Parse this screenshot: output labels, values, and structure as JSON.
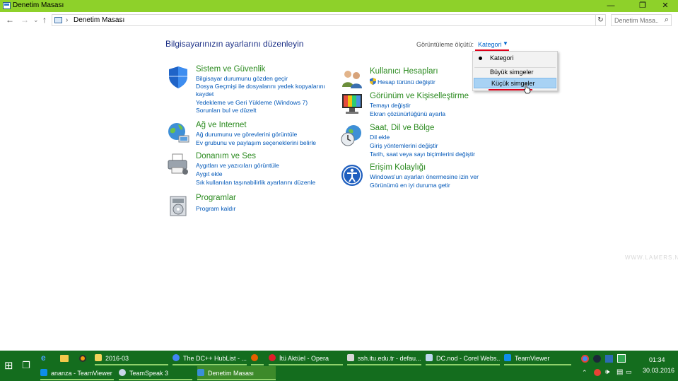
{
  "window": {
    "title": "Denetim Masası",
    "minimize": "—",
    "restore": "❐",
    "close": "✕"
  },
  "address": {
    "back": "←",
    "forward": "→",
    "recent": "⌄",
    "up": "↑",
    "separator": "›",
    "breadcrumb": "Denetim Masası",
    "breadcrumb_dropdown": "›",
    "refresh": "↻",
    "search_placeholder": "Denetim Masa...",
    "search_icon": "⌕"
  },
  "main": {
    "heading": "Bilgisayarınızın ayarlarını düzenleyin",
    "view_label": "Görüntüleme ölçütü:",
    "view_value": "Kategori",
    "view_caret": "▼"
  },
  "categories_left": [
    {
      "title": "Sistem ve Güvenlik",
      "icon": "shield-icon",
      "links": [
        "Bilgisayar durumunu gözden geçir",
        "Dosya Geçmişi ile dosyalarını yedek kopyalarını",
        "kaydet",
        "Yedekleme ve Geri Yükleme (Windows 7)",
        "Sorunları bul ve düzelt"
      ]
    },
    {
      "title": "Ağ ve Internet",
      "icon": "network-globe-icon",
      "links": [
        "Ağ durumunu ve görevlerini görüntüle",
        "Ev grubunu ve paylaşım seçeneklerini belirle"
      ]
    },
    {
      "title": "Donanım ve Ses",
      "icon": "printer-icon",
      "links": [
        "Aygıtları ve yazıcıları görüntüle",
        "Aygıt ekle",
        "Sık kullanılan taşınabilirlik ayarlarını düzenle"
      ]
    },
    {
      "title": "Programlar",
      "icon": "programs-disc-icon",
      "links": [
        "Program kaldır"
      ]
    }
  ],
  "categories_right": [
    {
      "title": "Kullanıcı Hesapları",
      "icon": "users-icon",
      "links": [
        "Hesap türünü değiştir"
      ]
    },
    {
      "title": "Görünüm ve Kişiselleştirme",
      "icon": "monitor-icon",
      "links": [
        "Temayı değiştir",
        "Ekran çözünürlüğünü ayarla"
      ]
    },
    {
      "title": "Saat, Dil ve Bölge",
      "icon": "clock-globe-icon",
      "links": [
        "Dil ekle",
        "Giriş yöntemlerini değiştir",
        "Tarih, saat veya sayı biçimlerini değiştir"
      ]
    },
    {
      "title": "Erişim Kolaylığı",
      "icon": "accessibility-icon",
      "links": [
        "Windows'un ayarları önermesine izin ver",
        "Görünümü en iyi duruma getir"
      ]
    }
  ],
  "dropdown": {
    "options": [
      "Kategori",
      "Büyük simgeler",
      "Küçük simgeler"
    ],
    "selected": "Kategori",
    "hovered": "Küçük simgeler"
  },
  "watermark": "WWW.LAMERS.NET",
  "taskbar": {
    "row1": [
      {
        "label": "2016-03",
        "color": "#f3d35b"
      },
      {
        "label": "The DC++ HubList - ...",
        "color": "#4285f4"
      },
      {
        "label": "",
        "color": "#e66000"
      },
      {
        "label": "İtü Aktüel - Opera",
        "color": "#e01e2a"
      },
      {
        "label": "ssh.itu.edu.tr - defau...",
        "color": "#d8d8d8"
      },
      {
        "label": "DC.nod - Corel Webs...",
        "color": "#bdd7ee"
      },
      {
        "label": "TeamViewer",
        "color": "#0e8ee9"
      }
    ],
    "row2": [
      {
        "label": "ananza - TeamViewer ...",
        "color": "#0e8ee9"
      },
      {
        "label": "TeamSpeak 3",
        "color": "#c9d6e8"
      },
      {
        "label": "Denetim Masası",
        "color": "#3a8fd8"
      }
    ],
    "start": "⊞",
    "taskview": "❐",
    "time": "01:34",
    "date": "30.03.2016"
  }
}
